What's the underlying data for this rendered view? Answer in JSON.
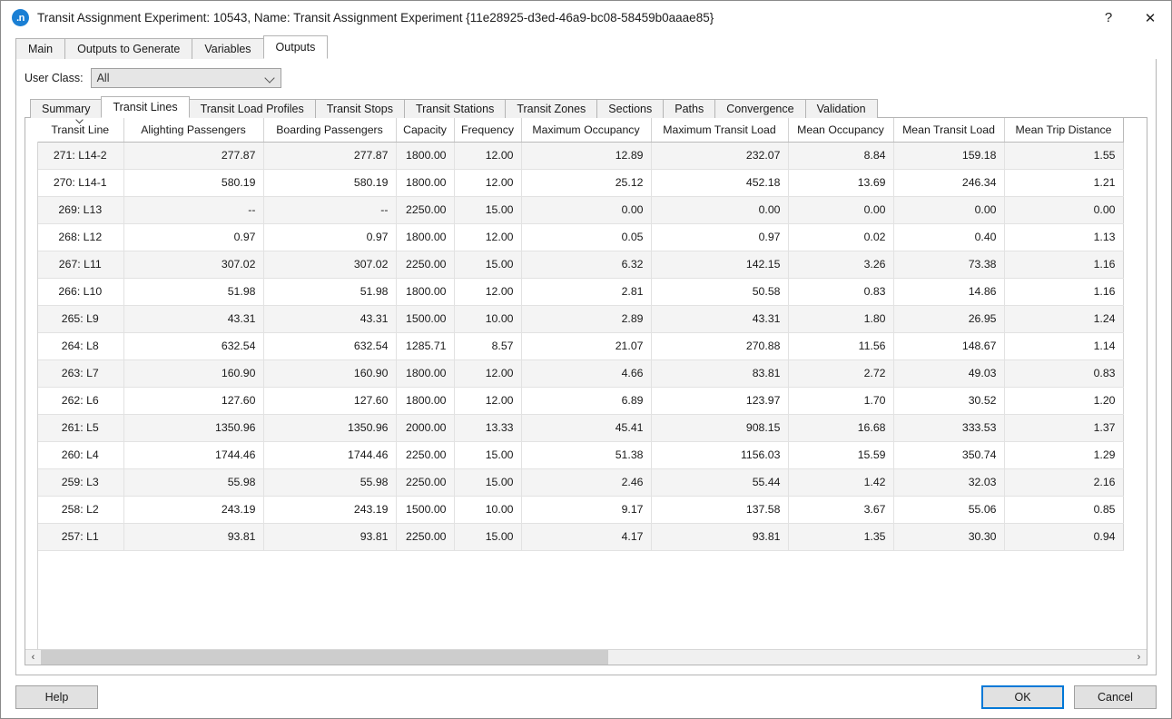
{
  "window": {
    "title": "Transit Assignment Experiment: 10543, Name: Transit Assignment Experiment  {11e28925-d3ed-46a9-bc08-58459b0aaae85}",
    "app_icon_text": ".n",
    "help_btn": "?",
    "close_btn": "✕",
    "accent": "#0078d7"
  },
  "outer_tabs": [
    {
      "label": "Main",
      "active": false
    },
    {
      "label": "Outputs to Generate",
      "active": false
    },
    {
      "label": "Variables",
      "active": false
    },
    {
      "label": "Outputs",
      "active": true
    }
  ],
  "user_class": {
    "label": "User Class:",
    "value": "All",
    "chevron": "chevron-down-icon"
  },
  "inner_tabs": [
    {
      "label": "Summary",
      "active": false
    },
    {
      "label": "Transit Lines",
      "active": true
    },
    {
      "label": "Transit Load Profiles",
      "active": false
    },
    {
      "label": "Transit Stops",
      "active": false
    },
    {
      "label": "Transit Stations",
      "active": false
    },
    {
      "label": "Transit Zones",
      "active": false
    },
    {
      "label": "Sections",
      "active": false
    },
    {
      "label": "Paths",
      "active": false
    },
    {
      "label": "Convergence",
      "active": false
    },
    {
      "label": "Validation",
      "active": false
    }
  ],
  "table": {
    "sort_column": "Transit Line",
    "sort_direction": "descending",
    "columns": [
      "Transit Line",
      "Alighting Passengers",
      "Boarding Passengers",
      "Capacity",
      "Frequency",
      "Maximum Occupancy",
      "Maximum Transit Load",
      "Mean Occupancy",
      "Mean Transit Load",
      "Mean Trip Distance"
    ],
    "rows": [
      [
        "271: L14-2",
        "277.87",
        "277.87",
        "1800.00",
        "12.00",
        "12.89",
        "232.07",
        "8.84",
        "159.18",
        "1.55"
      ],
      [
        "270: L14-1",
        "580.19",
        "580.19",
        "1800.00",
        "12.00",
        "25.12",
        "452.18",
        "13.69",
        "246.34",
        "1.21"
      ],
      [
        "269: L13",
        "--",
        "--",
        "2250.00",
        "15.00",
        "0.00",
        "0.00",
        "0.00",
        "0.00",
        "0.00"
      ],
      [
        "268: L12",
        "0.97",
        "0.97",
        "1800.00",
        "12.00",
        "0.05",
        "0.97",
        "0.02",
        "0.40",
        "1.13"
      ],
      [
        "267: L11",
        "307.02",
        "307.02",
        "2250.00",
        "15.00",
        "6.32",
        "142.15",
        "3.26",
        "73.38",
        "1.16"
      ],
      [
        "266: L10",
        "51.98",
        "51.98",
        "1800.00",
        "12.00",
        "2.81",
        "50.58",
        "0.83",
        "14.86",
        "1.16"
      ],
      [
        "265: L9",
        "43.31",
        "43.31",
        "1500.00",
        "10.00",
        "2.89",
        "43.31",
        "1.80",
        "26.95",
        "1.24"
      ],
      [
        "264: L8",
        "632.54",
        "632.54",
        "1285.71",
        "8.57",
        "21.07",
        "270.88",
        "11.56",
        "148.67",
        "1.14"
      ],
      [
        "263: L7",
        "160.90",
        "160.90",
        "1800.00",
        "12.00",
        "4.66",
        "83.81",
        "2.72",
        "49.03",
        "0.83"
      ],
      [
        "262: L6",
        "127.60",
        "127.60",
        "1800.00",
        "12.00",
        "6.89",
        "123.97",
        "1.70",
        "30.52",
        "1.20"
      ],
      [
        "261: L5",
        "1350.96",
        "1350.96",
        "2000.00",
        "13.33",
        "45.41",
        "908.15",
        "16.68",
        "333.53",
        "1.37"
      ],
      [
        "260: L4",
        "1744.46",
        "1744.46",
        "2250.00",
        "15.00",
        "51.38",
        "1156.03",
        "15.59",
        "350.74",
        "1.29"
      ],
      [
        "259: L3",
        "55.98",
        "55.98",
        "2250.00",
        "15.00",
        "2.46",
        "55.44",
        "1.42",
        "32.03",
        "2.16"
      ],
      [
        "258: L2",
        "243.19",
        "243.19",
        "1500.00",
        "10.00",
        "9.17",
        "137.58",
        "3.67",
        "55.06",
        "0.85"
      ],
      [
        "257: L1",
        "93.81",
        "93.81",
        "2250.00",
        "15.00",
        "4.17",
        "93.81",
        "1.35",
        "30.30",
        "0.94"
      ]
    ]
  },
  "scrollbar": {
    "left_arrow": "‹",
    "right_arrow": "›",
    "thumb_percent": 52
  },
  "footer": {
    "help": "Help",
    "ok": "OK",
    "cancel": "Cancel"
  }
}
